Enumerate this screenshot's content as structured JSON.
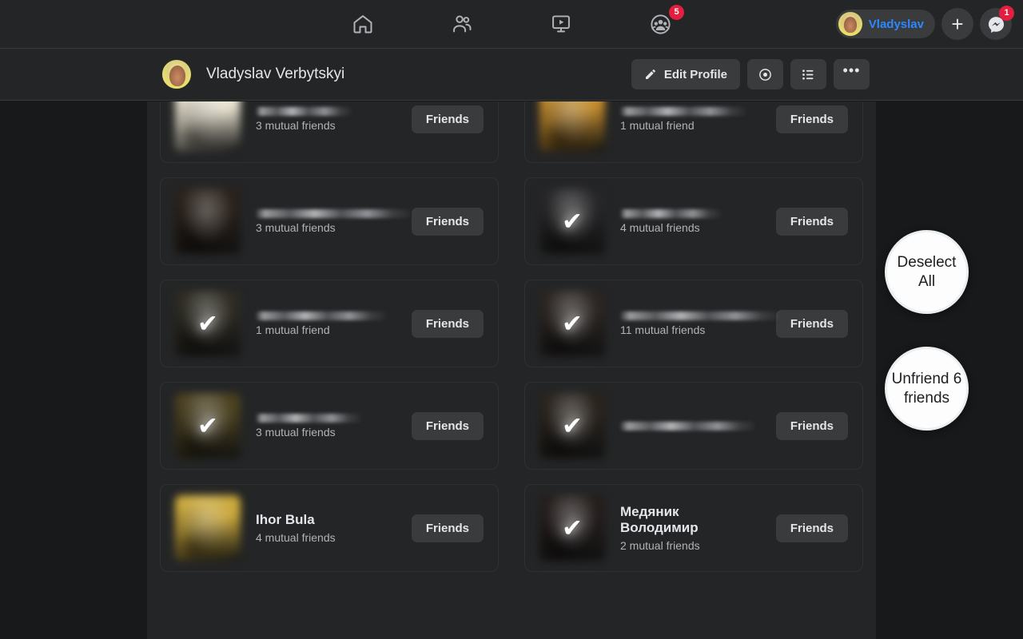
{
  "topnav": {
    "icons": [
      {
        "name": "home-icon",
        "label": "Home",
        "badge": null
      },
      {
        "name": "friends-icon",
        "label": "Friends",
        "badge": null
      },
      {
        "name": "watch-icon",
        "label": "Watch",
        "badge": null
      },
      {
        "name": "groups-icon",
        "label": "Groups",
        "badge": "5"
      }
    ],
    "profile_pill_name": "Vladyslav",
    "create_button_label": "+",
    "messenger_badge": "1",
    "messenger_icon": "messenger-icon",
    "badge_color": "#e41e3f",
    "accent_color": "#2d88ff"
  },
  "profile_header": {
    "name": "Vladyslav Verbytskyi",
    "edit_profile_label": "Edit Profile",
    "edit_icon": "pencil-icon",
    "view_as_icon": "eye-icon",
    "activity_log_icon": "list-icon",
    "more_label": "•••"
  },
  "friends": {
    "button_label": "Friends",
    "rows": [
      {
        "name": null,
        "mutual": "3 mutual friends",
        "selected": false,
        "avatar": "#e9e2cf"
      },
      {
        "name": null,
        "mutual": "1 mutual friend",
        "selected": false,
        "avatar": "#c28a2a"
      },
      {
        "name": null,
        "mutual": "3 mutual friends",
        "selected": false,
        "avatar": "#2a211a"
      },
      {
        "name": null,
        "mutual": "4 mutual friends",
        "selected": true,
        "avatar": "#262628"
      },
      {
        "name": null,
        "mutual": "1 mutual friend",
        "selected": true,
        "avatar": "#2d2b22"
      },
      {
        "name": null,
        "mutual": "11 mutual friends",
        "selected": true,
        "avatar": "#2b2522"
      },
      {
        "name": null,
        "mutual": "3 mutual friends",
        "selected": true,
        "avatar": "#4a4020"
      },
      {
        "name": null,
        "mutual": null,
        "selected": true,
        "avatar": "#29231d"
      },
      {
        "name": "Ihor Bula",
        "mutual": "4 mutual friends",
        "selected": false,
        "avatar": "#caa83c"
      },
      {
        "name": "Медяник Володимир",
        "mutual": "2 mutual friends",
        "selected": true,
        "avatar": "#241d1c"
      }
    ]
  },
  "floating_actions": {
    "deselect_label": "Deselect All",
    "unfriend_label": "Unfriend 6 friends"
  }
}
